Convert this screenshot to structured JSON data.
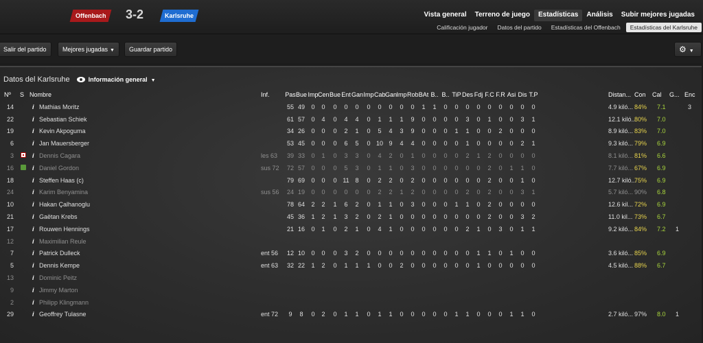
{
  "header": {
    "home_team": "Offenbach",
    "away_team": "Karlsruhe",
    "score": "3-2",
    "home_color": "#a8191b",
    "away_color": "#1f6dd1"
  },
  "nav_main": [
    "Vista general",
    "Terreno de juego",
    "Estadísticas",
    "Análisis",
    "Subir mejores jugadas"
  ],
  "nav_sub": [
    "Calificación jugador",
    "Datos del partido",
    "Estadísticas del Offenbach",
    "Estadísticas del Karlsruhe"
  ],
  "toolbar": {
    "exit": "Salir del partido",
    "highlights": "Mejores jugadas",
    "save": "Guardar partido",
    "settings_icon": "gear-icon"
  },
  "panel": {
    "title": "Datos del Karlsruhe",
    "view": "Información general"
  },
  "columns": [
    "Nº",
    "S",
    "Nombre",
    "Inf.",
    "Pas",
    "Bue",
    "Imp",
    "Cen",
    "Bue",
    "Ent",
    "Gan",
    "Imp",
    "Cab",
    "Gan",
    "Imp",
    "Rob",
    "BAt",
    "B..",
    "B..",
    "TiP",
    "Des",
    "Fdj",
    "F.C",
    "F.R",
    "Asi",
    "Dis",
    "T.P",
    "Distan...",
    "Con",
    "Cal",
    "G...",
    "Enc"
  ],
  "rows": [
    {
      "no": "14",
      "s": "",
      "name": "Mathias Moritz",
      "inf": "",
      "stats": [
        "55",
        "49",
        "0",
        "0",
        "0",
        "0",
        "0",
        "0",
        "0",
        "0",
        "0",
        "0",
        "1",
        "1",
        "0",
        "0",
        "0",
        "0",
        "0",
        "0",
        "0",
        "0",
        "0"
      ],
      "dist": "4.9 kiló...",
      "con": "84%",
      "cal": "7.1",
      "g": "",
      "enc": "3",
      "muted": false
    },
    {
      "no": "22",
      "s": "",
      "name": "Sebastian Schiek",
      "inf": "",
      "stats": [
        "61",
        "57",
        "0",
        "4",
        "0",
        "4",
        "4",
        "0",
        "1",
        "1",
        "1",
        "9",
        "0",
        "0",
        "0",
        "0",
        "3",
        "0",
        "1",
        "0",
        "0",
        "3",
        "1"
      ],
      "dist": "12.1 kiló...",
      "con": "80%",
      "cal": "7.0",
      "g": "",
      "enc": "",
      "muted": false
    },
    {
      "no": "19",
      "s": "",
      "name": "Kevin Akpoguma",
      "inf": "",
      "stats": [
        "34",
        "26",
        "0",
        "0",
        "0",
        "2",
        "1",
        "0",
        "5",
        "4",
        "3",
        "9",
        "0",
        "0",
        "0",
        "1",
        "1",
        "0",
        "0",
        "2",
        "0",
        "0",
        "0"
      ],
      "dist": "8.9 kiló...",
      "con": "83%",
      "cal": "7.0",
      "g": "",
      "enc": "",
      "muted": false
    },
    {
      "no": "6",
      "s": "",
      "name": "Jan Mauersberger",
      "inf": "",
      "stats": [
        "53",
        "45",
        "0",
        "0",
        "0",
        "6",
        "5",
        "0",
        "10",
        "9",
        "4",
        "4",
        "0",
        "0",
        "0",
        "0",
        "1",
        "0",
        "0",
        "0",
        "0",
        "2",
        "1"
      ],
      "dist": "9.3 kiló...",
      "con": "79%",
      "cal": "6.9",
      "g": "",
      "enc": "",
      "muted": false
    },
    {
      "no": "3",
      "s": "red",
      "name": "Dennis Cagara",
      "inf": "les 63",
      "stats": [
        "39",
        "33",
        "0",
        "1",
        "0",
        "3",
        "3",
        "0",
        "4",
        "2",
        "0",
        "1",
        "0",
        "0",
        "0",
        "0",
        "2",
        "1",
        "2",
        "0",
        "0",
        "0",
        "0"
      ],
      "dist": "8.1 kiló...",
      "con": "81%",
      "cal": "6.6",
      "g": "",
      "enc": "",
      "muted": true
    },
    {
      "no": "16",
      "s": "green",
      "name": "Daniel Gordon",
      "inf": "sus 72",
      "stats": [
        "72",
        "57",
        "0",
        "0",
        "0",
        "5",
        "3",
        "0",
        "1",
        "1",
        "0",
        "3",
        "0",
        "0",
        "0",
        "0",
        "0",
        "0",
        "2",
        "0",
        "1",
        "1",
        "0"
      ],
      "dist": "7.7 kiló...",
      "con": "67%",
      "cal": "6.9",
      "g": "",
      "enc": "",
      "muted": true
    },
    {
      "no": "18",
      "s": "",
      "name": "Steffen Haas (c)",
      "inf": "",
      "stats": [
        "79",
        "69",
        "0",
        "0",
        "0",
        "11",
        "8",
        "0",
        "2",
        "2",
        "0",
        "2",
        "0",
        "0",
        "0",
        "0",
        "0",
        "0",
        "2",
        "0",
        "0",
        "1",
        "0"
      ],
      "dist": "12.7 kiló...",
      "con": "75%",
      "cal": "6.9",
      "g": "",
      "enc": "",
      "muted": false
    },
    {
      "no": "24",
      "s": "",
      "name": "Karim Benyamina",
      "inf": "sus 56",
      "stats": [
        "24",
        "19",
        "0",
        "0",
        "0",
        "0",
        "0",
        "0",
        "2",
        "2",
        "1",
        "2",
        "0",
        "0",
        "0",
        "0",
        "2",
        "0",
        "2",
        "0",
        "0",
        "3",
        "1"
      ],
      "dist": "5.7 kiló...",
      "con": "90%",
      "cal": "6.8",
      "g": "",
      "enc": "",
      "muted": true
    },
    {
      "no": "10",
      "s": "",
      "name": "Hakan Çalhanoglu",
      "inf": "",
      "stats": [
        "78",
        "64",
        "2",
        "2",
        "1",
        "6",
        "2",
        "0",
        "1",
        "1",
        "0",
        "3",
        "0",
        "0",
        "0",
        "1",
        "1",
        "0",
        "2",
        "0",
        "0",
        "0",
        "0"
      ],
      "dist": "12.6 kil...",
      "con": "72%",
      "cal": "6.9",
      "g": "",
      "enc": "",
      "muted": false
    },
    {
      "no": "21",
      "s": "",
      "name": "Gaëtan Krebs",
      "inf": "",
      "stats": [
        "45",
        "36",
        "1",
        "2",
        "1",
        "3",
        "2",
        "0",
        "2",
        "1",
        "0",
        "0",
        "0",
        "0",
        "0",
        "0",
        "0",
        "0",
        "2",
        "0",
        "0",
        "3",
        "2"
      ],
      "dist": "11.0 kil...",
      "con": "73%",
      "cal": "6.7",
      "g": "",
      "enc": "",
      "muted": false
    },
    {
      "no": "17",
      "s": "",
      "name": "Rouwen Hennings",
      "inf": "",
      "stats": [
        "21",
        "16",
        "0",
        "1",
        "0",
        "2",
        "1",
        "0",
        "4",
        "1",
        "0",
        "0",
        "0",
        "0",
        "0",
        "0",
        "2",
        "1",
        "0",
        "3",
        "0",
        "1",
        "1"
      ],
      "dist": "9.2 kiló...",
      "con": "84%",
      "cal": "7.2",
      "g": "1",
      "enc": "",
      "muted": false
    },
    {
      "no": "12",
      "s": "",
      "name": "Maximilian Reule",
      "inf": "",
      "stats": [],
      "dist": "",
      "con": "",
      "cal": "",
      "g": "",
      "enc": "",
      "muted": true
    },
    {
      "no": "7",
      "s": "",
      "name": "Patrick Dulleck",
      "inf": "ent 56",
      "stats": [
        "12",
        "10",
        "0",
        "0",
        "0",
        "3",
        "2",
        "0",
        "0",
        "0",
        "0",
        "0",
        "0",
        "0",
        "0",
        "0",
        "0",
        "1",
        "1",
        "0",
        "1",
        "0",
        "0"
      ],
      "dist": "3.6 kiló...",
      "con": "85%",
      "cal": "6.9",
      "g": "",
      "enc": "",
      "muted": false
    },
    {
      "no": "5",
      "s": "",
      "name": "Dennis Kempe",
      "inf": "ent 63",
      "stats": [
        "32",
        "22",
        "1",
        "2",
        "0",
        "1",
        "1",
        "1",
        "0",
        "0",
        "2",
        "0",
        "0",
        "0",
        "0",
        "0",
        "0",
        "1",
        "0",
        "0",
        "0",
        "0",
        "0"
      ],
      "dist": "4.5 kiló...",
      "con": "88%",
      "cal": "6.7",
      "g": "",
      "enc": "",
      "muted": false
    },
    {
      "no": "13",
      "s": "",
      "name": "Dominic Peitz",
      "inf": "",
      "stats": [],
      "dist": "",
      "con": "",
      "cal": "",
      "g": "",
      "enc": "",
      "muted": true
    },
    {
      "no": "9",
      "s": "",
      "name": "Jimmy Marton",
      "inf": "",
      "stats": [],
      "dist": "",
      "con": "",
      "cal": "",
      "g": "",
      "enc": "",
      "muted": true
    },
    {
      "no": "2",
      "s": "",
      "name": "Philipp Klingmann",
      "inf": "",
      "stats": [],
      "dist": "",
      "con": "",
      "cal": "",
      "g": "",
      "enc": "",
      "muted": true
    },
    {
      "no": "29",
      "s": "",
      "name": "Geoffrey Tulasne",
      "inf": "ent 72",
      "stats": [
        "9",
        "8",
        "0",
        "2",
        "0",
        "1",
        "1",
        "0",
        "1",
        "1",
        "0",
        "0",
        "0",
        "0",
        "0",
        "1",
        "1",
        "0",
        "0",
        "0",
        "1",
        "1",
        "0"
      ],
      "dist": "2.7 kiló...",
      "con": "97%",
      "cal": "8.0",
      "g": "1",
      "enc": "",
      "muted": false
    }
  ]
}
